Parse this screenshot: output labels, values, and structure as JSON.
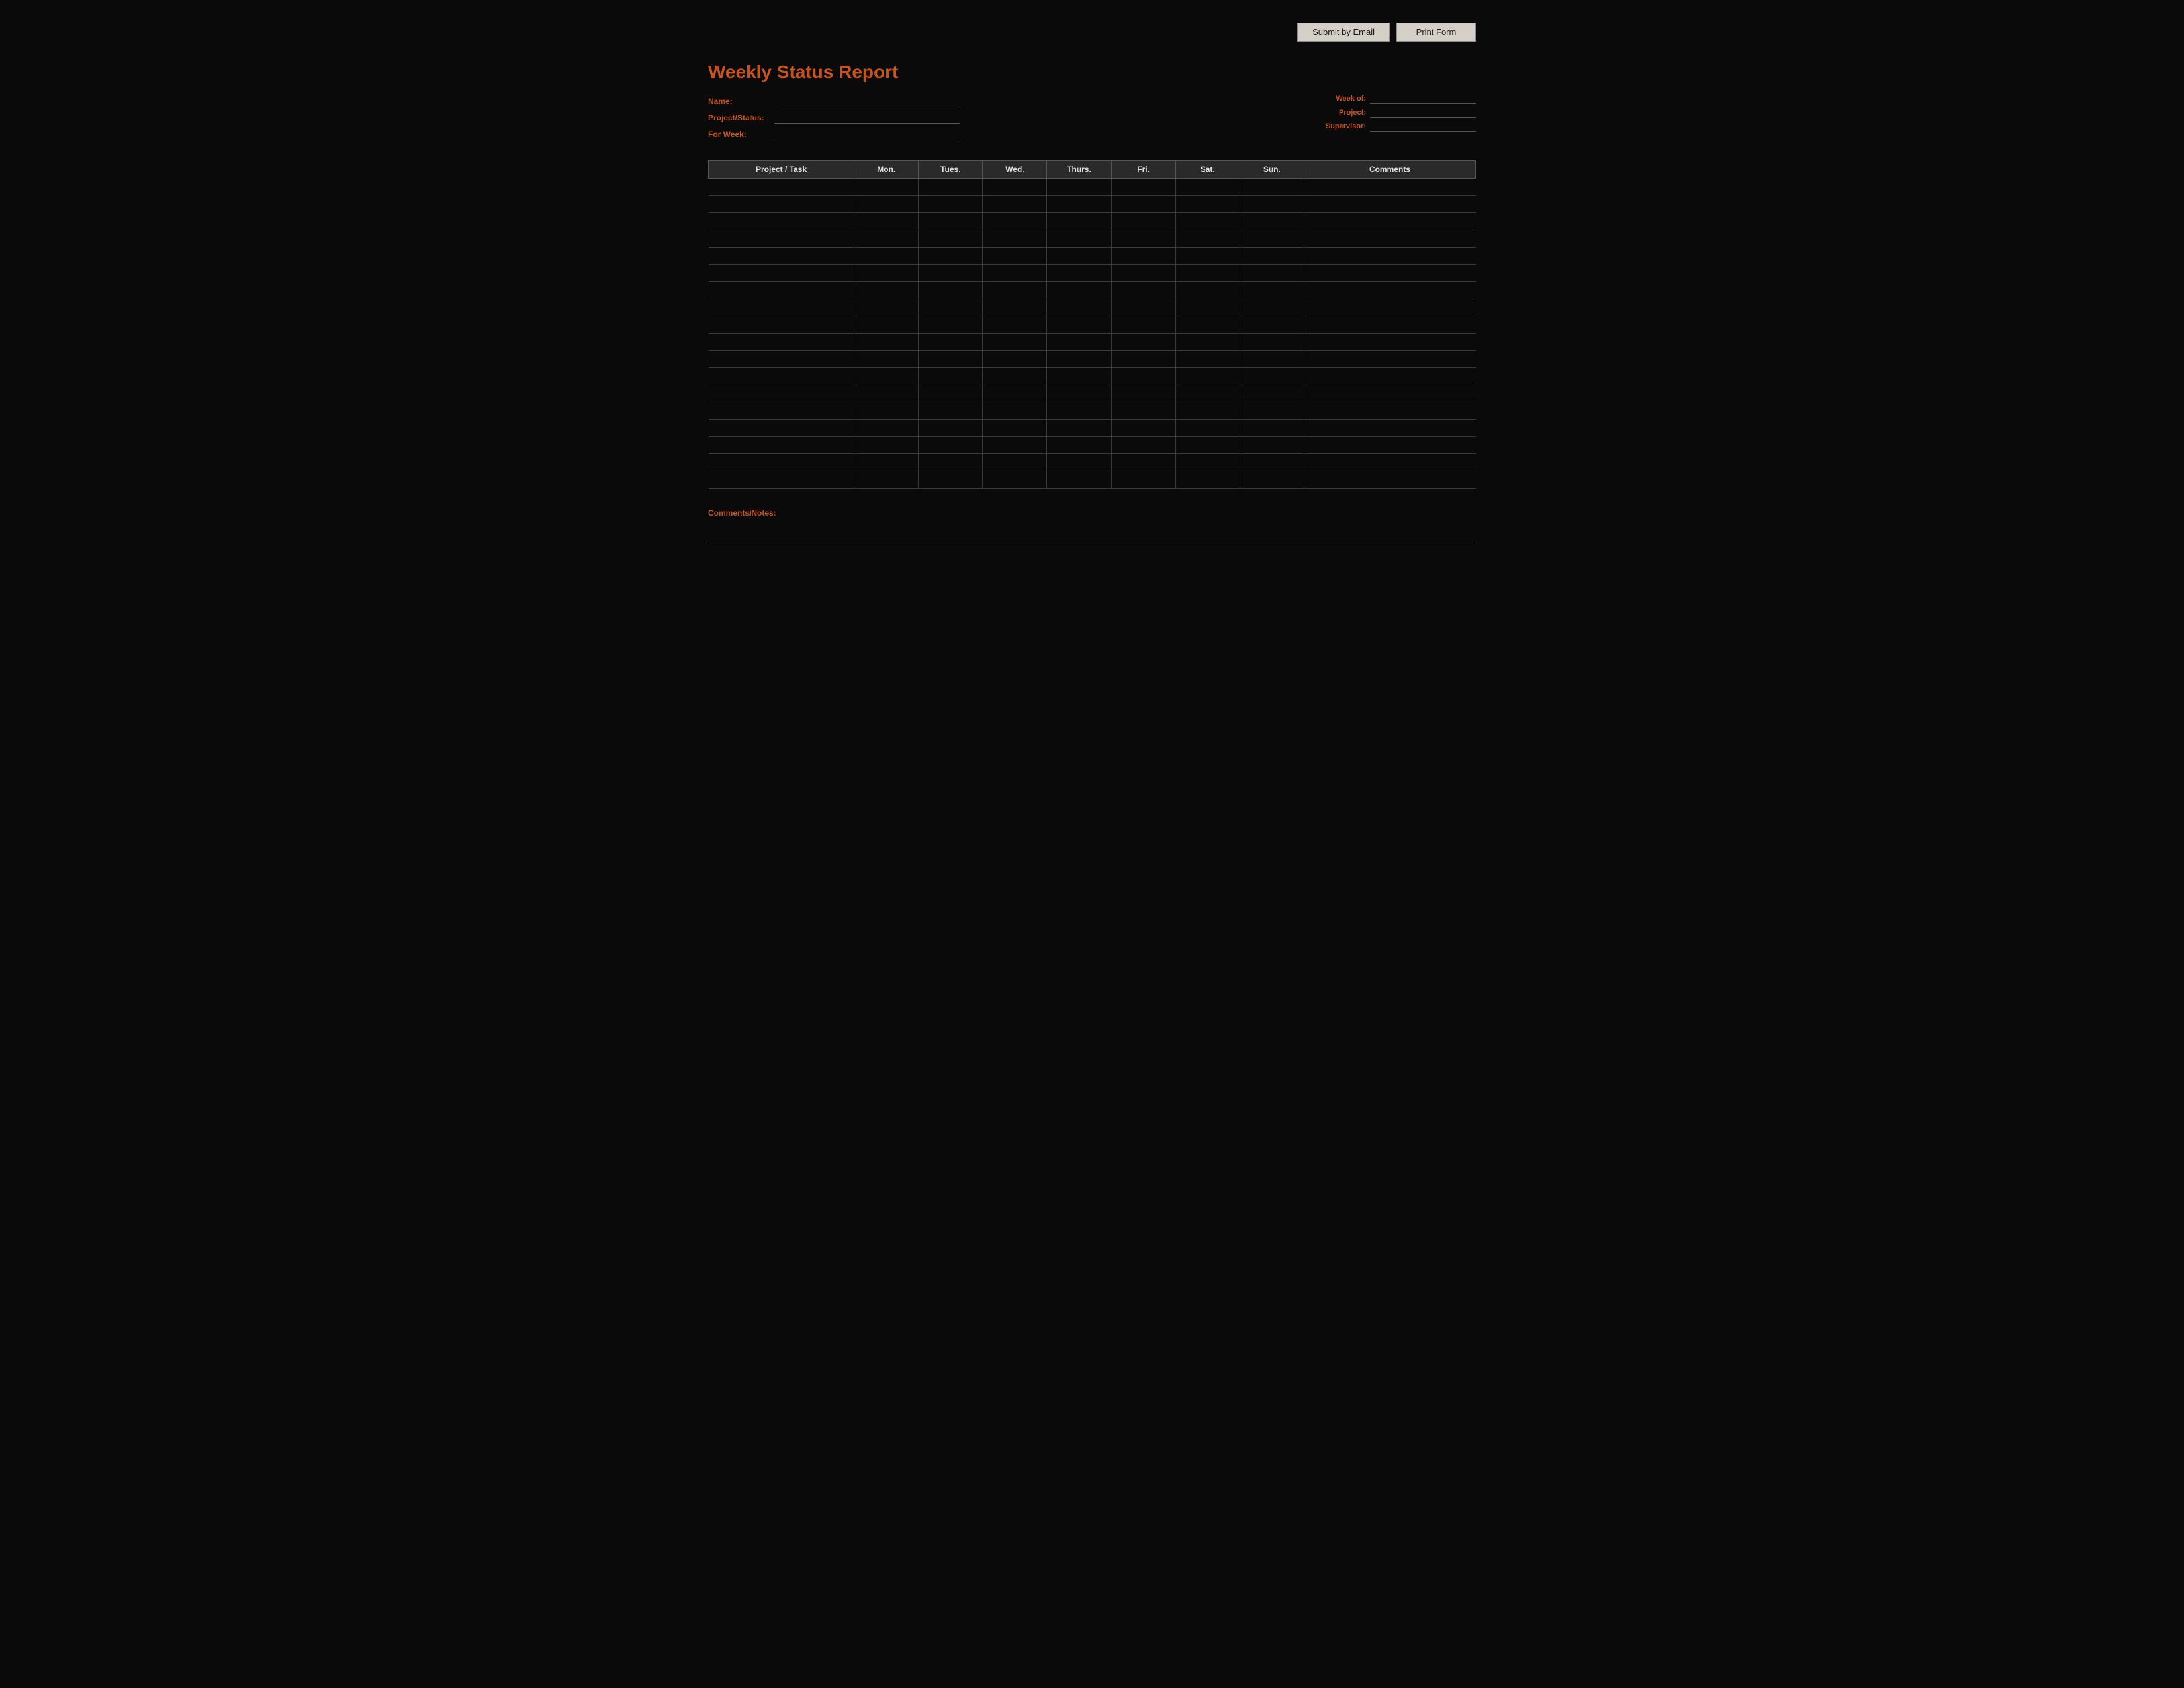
{
  "page": {
    "title": "Weekly Status Report",
    "background": "#0a0a0a"
  },
  "toolbar": {
    "submit_email_label": "Submit by Email",
    "print_form_label": "Print Form"
  },
  "form": {
    "name_label": "Name:",
    "name_value": "",
    "project_status_label": "Project/Status:",
    "project_status_value": "",
    "for_week_label": "For Week:",
    "for_week_value": "",
    "week_of_label": "Week of:",
    "week_of_value": "",
    "project_label": "Project:",
    "project_value": "",
    "supervisor_label": "Supervisor:",
    "supervisor_value": ""
  },
  "table": {
    "headers": [
      "Project / Task",
      "Mon.",
      "Tues.",
      "Wed.",
      "Thurs.",
      "Fri.",
      "Sat.",
      "Sun.",
      "Comments"
    ],
    "num_rows": 18
  },
  "comments": {
    "label": "Comments/Notes:",
    "value": ""
  }
}
